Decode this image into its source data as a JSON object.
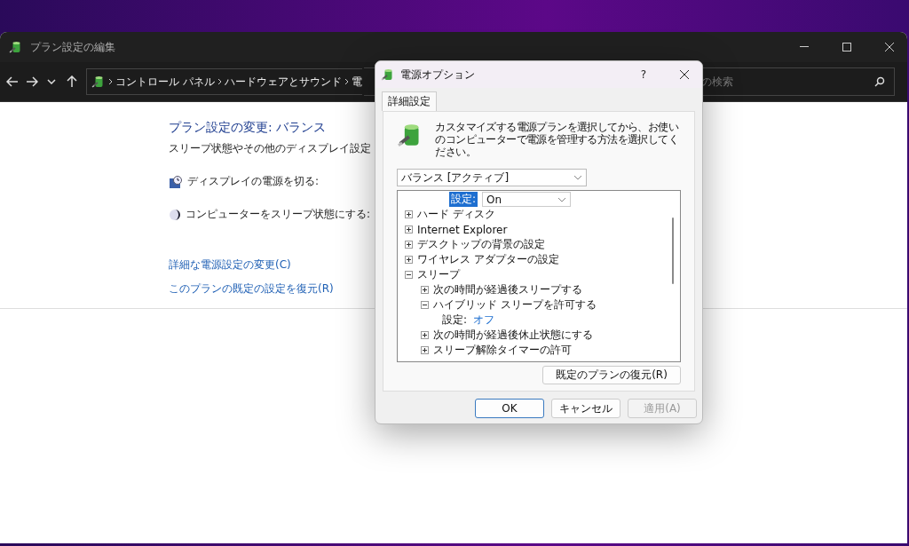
{
  "window": {
    "title": "プラン設定の編集"
  },
  "breadcrumb": [
    "コントロール パネル",
    "ハードウェアとサウンド",
    "電"
  ],
  "search": {
    "placeholder": "の検索"
  },
  "content": {
    "heading": "プラン設定の変更: バランス",
    "subtitle": "スリープ状態やその他のディスプレイ設定",
    "settings": [
      {
        "kind": "display",
        "label": "ディスプレイの電源を切る:"
      },
      {
        "kind": "sleep",
        "label": "コンピューターをスリープ状態にする:"
      }
    ],
    "links": [
      "詳細な電源設定の変更(C)",
      "このプランの既定の設定を復元(R)"
    ]
  },
  "dialog": {
    "title": "電源オプション",
    "help": "?",
    "tabs": [
      {
        "label": "詳細設定",
        "selected": true
      }
    ],
    "description": "カスタマイズする電源プランを選択してから、お使いのコンピューターで電源を管理する方法を選択してください。",
    "plan": "バランス [アクティブ]",
    "tree": [
      {
        "kind": "editor",
        "label": "設定:",
        "value": "On"
      },
      {
        "kind": "group",
        "label": "ハード ディスク",
        "expanded": false
      },
      {
        "kind": "group",
        "label": "Internet Explorer",
        "expanded": false
      },
      {
        "kind": "group",
        "label": "デスクトップの背景の設定",
        "expanded": false
      },
      {
        "kind": "group",
        "label": "ワイヤレス アダプターの設定",
        "expanded": false
      },
      {
        "kind": "group",
        "label": "スリープ",
        "expanded": true,
        "children": [
          {
            "kind": "group",
            "label": "次の時間が経過後スリープする",
            "expanded": false
          },
          {
            "kind": "group",
            "label": "ハイブリッド スリープを許可する",
            "expanded": true,
            "children": [
              {
                "kind": "setting",
                "label": "設定:",
                "value": "オフ"
              }
            ]
          },
          {
            "kind": "group",
            "label": "次の時間が経過後休止状態にする",
            "expanded": false
          },
          {
            "kind": "group",
            "label": "スリープ解除タイマーの許可",
            "expanded": false
          }
        ]
      }
    ],
    "restore_button": "既定のプランの復元(R)",
    "buttons": [
      {
        "label": "OK",
        "kind": "default",
        "disabled": false
      },
      {
        "label": "キャンセル",
        "kind": "normal",
        "disabled": false
      },
      {
        "label": "適用(A)",
        "kind": "normal",
        "disabled": true
      }
    ]
  }
}
